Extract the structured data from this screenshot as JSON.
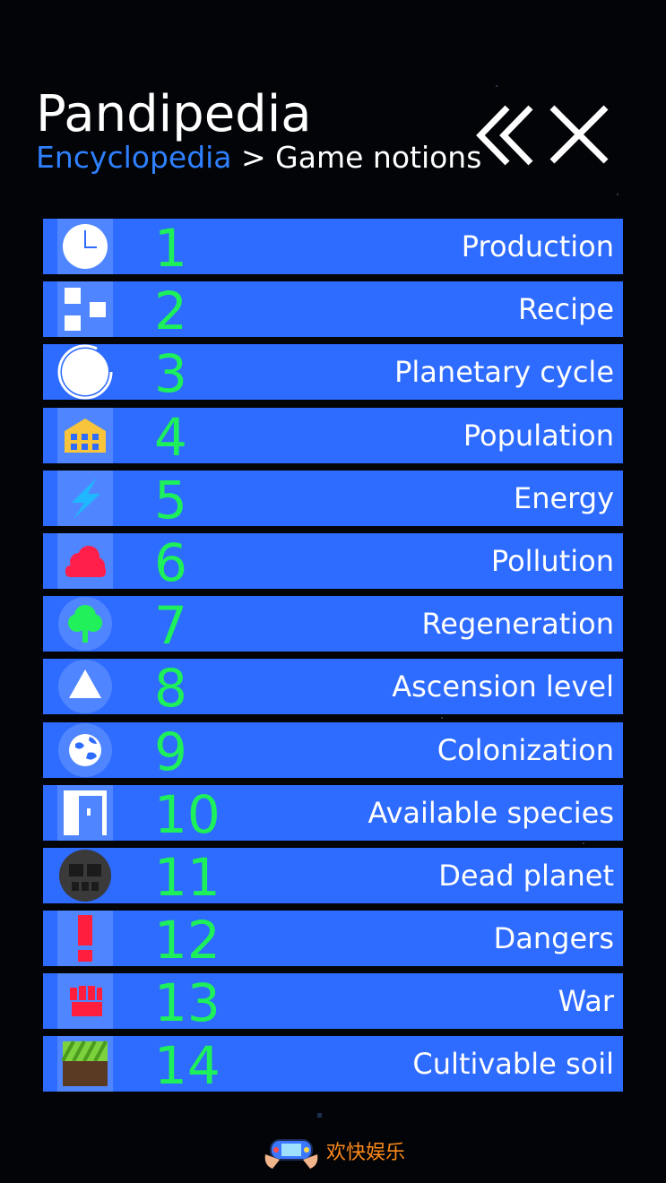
{
  "header": {
    "title": "Pandipedia",
    "breadcrumb_link": "Encyclopedia",
    "breadcrumb_separator": " > ",
    "breadcrumb_current": "Game notions"
  },
  "toolbar": {
    "back_icon": "double-chevron-left-icon",
    "close_icon": "close-icon"
  },
  "colors": {
    "background": "#020407",
    "row_background": "#2e6bff",
    "number_color": "#1df05a",
    "link_color": "#2f80ff",
    "footer_text": "#ff8a1a"
  },
  "items": [
    {
      "number": "1",
      "label": "Production",
      "icon": "clock-icon"
    },
    {
      "number": "2",
      "label": "Recipe",
      "icon": "recipe-blocks-icon"
    },
    {
      "number": "3",
      "label": "Planetary cycle",
      "icon": "cycle-ring-icon"
    },
    {
      "number": "4",
      "label": "Population",
      "icon": "building-icon"
    },
    {
      "number": "5",
      "label": "Energy",
      "icon": "lightning-icon"
    },
    {
      "number": "6",
      "label": "Pollution",
      "icon": "pollution-cloud-icon"
    },
    {
      "number": "7",
      "label": "Regeneration",
      "icon": "tree-icon"
    },
    {
      "number": "8",
      "label": "Ascension level",
      "icon": "triangle-up-icon"
    },
    {
      "number": "9",
      "label": "Colonization",
      "icon": "globe-icon"
    },
    {
      "number": "10",
      "label": "Available species",
      "icon": "door-icon"
    },
    {
      "number": "11",
      "label": "Dead planet",
      "icon": "skull-icon"
    },
    {
      "number": "12",
      "label": "Dangers",
      "icon": "exclamation-icon"
    },
    {
      "number": "13",
      "label": "War",
      "icon": "fist-icon"
    },
    {
      "number": "14",
      "label": "Cultivable soil",
      "icon": "grass-block-icon"
    }
  ],
  "footer": {
    "watermark_text": "欢快娱乐",
    "watermark_icon": "gamepad-hands-icon"
  }
}
